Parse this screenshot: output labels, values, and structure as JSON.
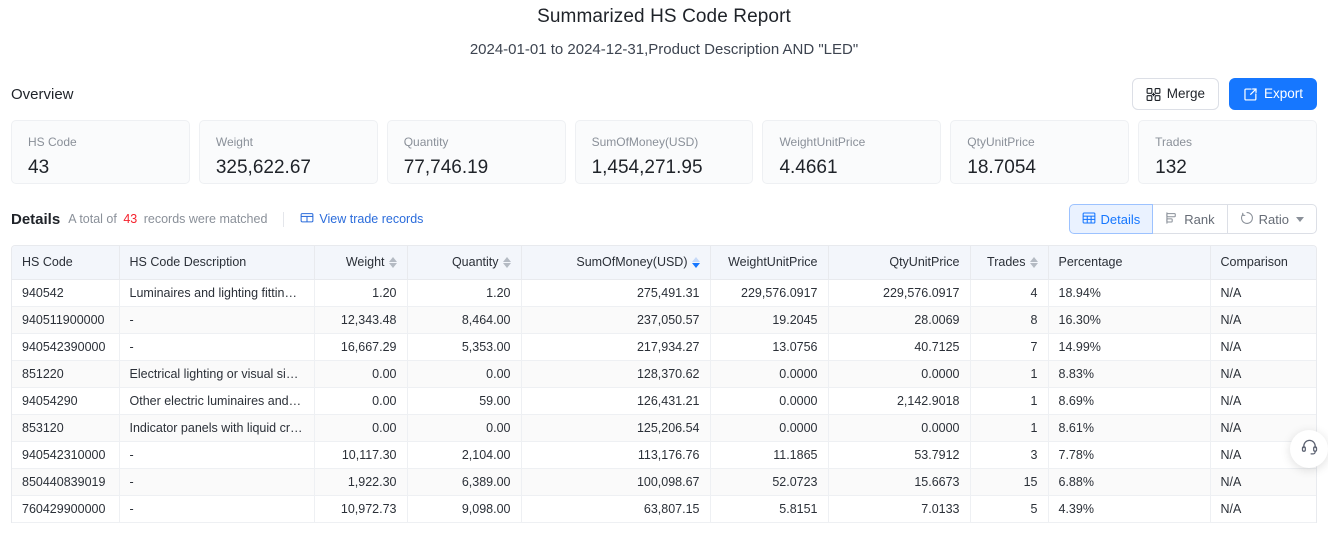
{
  "report": {
    "title": "Summarized HS Code Report",
    "subtitle": "2024-01-01 to 2024-12-31,Product Description AND \"LED\""
  },
  "overview": {
    "label": "Overview",
    "merge_label": "Merge",
    "export_label": "Export",
    "cards": [
      {
        "label": "HS Code",
        "value": "43"
      },
      {
        "label": "Weight",
        "value": "325,622.67"
      },
      {
        "label": "Quantity",
        "value": "77,746.19"
      },
      {
        "label": "SumOfMoney(USD)",
        "value": "1,454,271.95"
      },
      {
        "label": "WeightUnitPrice",
        "value": "4.4661"
      },
      {
        "label": "QtyUnitPrice",
        "value": "18.7054"
      },
      {
        "label": "Trades",
        "value": "132"
      }
    ]
  },
  "details": {
    "title": "Details",
    "meta_prefix": "A total of",
    "count": "43",
    "meta_suffix": "records were matched",
    "view_records_label": "View trade records",
    "view_modes": [
      {
        "label": "Details",
        "icon": "table-grid-icon",
        "active": true
      },
      {
        "label": "Rank",
        "icon": "rank-bars-icon",
        "active": false
      },
      {
        "label": "Ratio",
        "icon": "ratio-circle-icon",
        "active": false,
        "dropdown": true
      }
    ]
  },
  "table": {
    "columns": [
      {
        "label": "HS Code",
        "align": "left",
        "sortable": false
      },
      {
        "label": "HS Code Description",
        "align": "left",
        "sortable": false
      },
      {
        "label": "Weight",
        "align": "right",
        "sortable": true,
        "sorted": false
      },
      {
        "label": "Quantity",
        "align": "right",
        "sortable": true,
        "sorted": false
      },
      {
        "label": "SumOfMoney(USD)",
        "align": "right",
        "sortable": true,
        "sorted": true
      },
      {
        "label": "WeightUnitPrice",
        "align": "right",
        "sortable": false
      },
      {
        "label": "QtyUnitPrice",
        "align": "right",
        "sortable": false
      },
      {
        "label": "Trades",
        "align": "right",
        "sortable": true,
        "sorted": false
      },
      {
        "label": "Percentage",
        "align": "left",
        "sortable": false
      },
      {
        "label": "Comparison",
        "align": "left",
        "sortable": false
      }
    ],
    "rows": [
      [
        "940542",
        "Luminaires and lighting fittings, s...",
        "1.20",
        "1.20",
        "275,491.31",
        "229,576.0917",
        "229,576.0917",
        "4",
        "18.94%",
        "N/A"
      ],
      [
        "940511900000",
        "-",
        "12,343.48",
        "8,464.00",
        "237,050.57",
        "19.2045",
        "28.0069",
        "8",
        "16.30%",
        "N/A"
      ],
      [
        "940542390000",
        "-",
        "16,667.29",
        "5,353.00",
        "217,934.27",
        "13.0756",
        "40.7125",
        "7",
        "14.99%",
        "N/A"
      ],
      [
        "851220",
        "Electrical lighting or visual signall...",
        "0.00",
        "0.00",
        "128,370.62",
        "0.0000",
        "0.0000",
        "1",
        "8.83%",
        "N/A"
      ],
      [
        "94054290",
        "Other electric luminaires and light...",
        "0.00",
        "59.00",
        "126,431.21",
        "0.0000",
        "2,142.9018",
        "1",
        "8.69%",
        "N/A"
      ],
      [
        "853120",
        "Indicator panels with liquid crysta...",
        "0.00",
        "0.00",
        "125,206.54",
        "0.0000",
        "0.0000",
        "1",
        "8.61%",
        "N/A"
      ],
      [
        "940542310000",
        "-",
        "10,117.30",
        "2,104.00",
        "113,176.76",
        "11.1865",
        "53.7912",
        "3",
        "7.78%",
        "N/A"
      ],
      [
        "850440839019",
        "-",
        "1,922.30",
        "6,389.00",
        "100,098.67",
        "52.0723",
        "15.6673",
        "15",
        "6.88%",
        "N/A"
      ],
      [
        "760429900000",
        "-",
        "10,972.73",
        "9,098.00",
        "63,807.15",
        "5.8151",
        "7.0133",
        "5",
        "4.39%",
        "N/A"
      ]
    ]
  },
  "support": {
    "icon": "headset-icon"
  },
  "colors": {
    "primary": "#1677ff",
    "link": "#2b6cdb",
    "count_red": "#f5222d",
    "header_bg": "#f3f6fb",
    "card_bg": "#fafbfc"
  }
}
